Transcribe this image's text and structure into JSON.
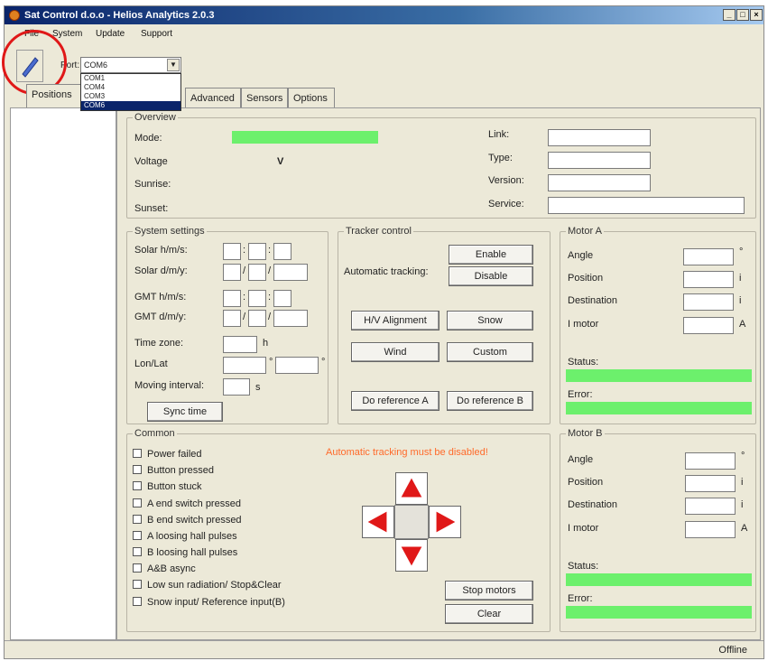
{
  "window": {
    "title": "Sat Control d.o.o - Helios Analytics 2.0.3",
    "buttons": {
      "minimize": "_",
      "maximize": "□",
      "close": "×"
    }
  },
  "menu": {
    "file": "File",
    "system": "System",
    "update": "Update",
    "support": "Support"
  },
  "toolbar": {
    "port_label": "Port:",
    "port_value": "COM6",
    "port_options": [
      "COM1",
      "COM4",
      "COM3",
      "COM6"
    ]
  },
  "tabs": {
    "positions": "Positions",
    "advanced": "Advanced",
    "sensors": "Sensors",
    "options": "Options"
  },
  "overview": {
    "title": "Overview",
    "mode": "Mode:",
    "voltage": "Voltage",
    "voltage_unit": "V",
    "sunrise": "Sunrise:",
    "sunset": "Sunset:",
    "link": "Link:",
    "type": "Type:",
    "version": "Version:",
    "service": "Service:"
  },
  "system_settings": {
    "title": "System settings",
    "solar_hms": "Solar h/m/s:",
    "solar_dmy": "Solar d/m/y:",
    "gmt_hms": "GMT h/m/s:",
    "gmt_dmy": "GMT d/m/y:",
    "time_zone": "Time zone:",
    "time_zone_unit": "h",
    "lon_lat": "Lon/Lat",
    "deg": "°",
    "moving_interval": "Moving interval:",
    "moving_unit": "s",
    "sync_time": "Sync time",
    "colon": ":",
    "slash": "/"
  },
  "tracker": {
    "title": "Tracker control",
    "auto_tracking": "Automatic tracking:",
    "enable": "Enable",
    "disable": "Disable",
    "hv_alignment": "H/V Alignment",
    "snow": "Snow",
    "wind": "Wind",
    "custom": "Custom",
    "ref_a": "Do reference A",
    "ref_b": "Do reference B"
  },
  "motor_a": {
    "title": "Motor A",
    "angle": "Angle",
    "angle_unit": "°",
    "position": "Position",
    "position_unit": "i",
    "destination": "Destination",
    "destination_unit": "i",
    "imotor": "I motor",
    "imotor_unit": "A",
    "status": "Status:",
    "error": "Error:"
  },
  "motor_b": {
    "title": "Motor B",
    "angle": "Angle",
    "angle_unit": "°",
    "position": "Position",
    "position_unit": "i",
    "destination": "Destination",
    "destination_unit": "i",
    "imotor": "I motor",
    "imotor_unit": "A",
    "status": "Status:",
    "error": "Error:"
  },
  "common": {
    "title": "Common",
    "warning": "Automatic tracking must be disabled!",
    "checks": [
      "Power failed",
      "Button pressed",
      "Button stuck",
      "A end switch pressed",
      "B end switch pressed",
      "A loosing hall pulses",
      "B loosing hall pulses",
      "A&B async",
      "Low sun radiation/ Stop&Clear",
      "Snow input/ Reference input(B)"
    ],
    "stop_motors": "Stop motors",
    "clear": "Clear"
  },
  "colors": {
    "status_green": "#6cf06c",
    "arrow_red": "#e01818",
    "warning": "#ff6a2a",
    "highlight_circle": "#e01818"
  },
  "status_bar": {
    "text": "Offline"
  }
}
